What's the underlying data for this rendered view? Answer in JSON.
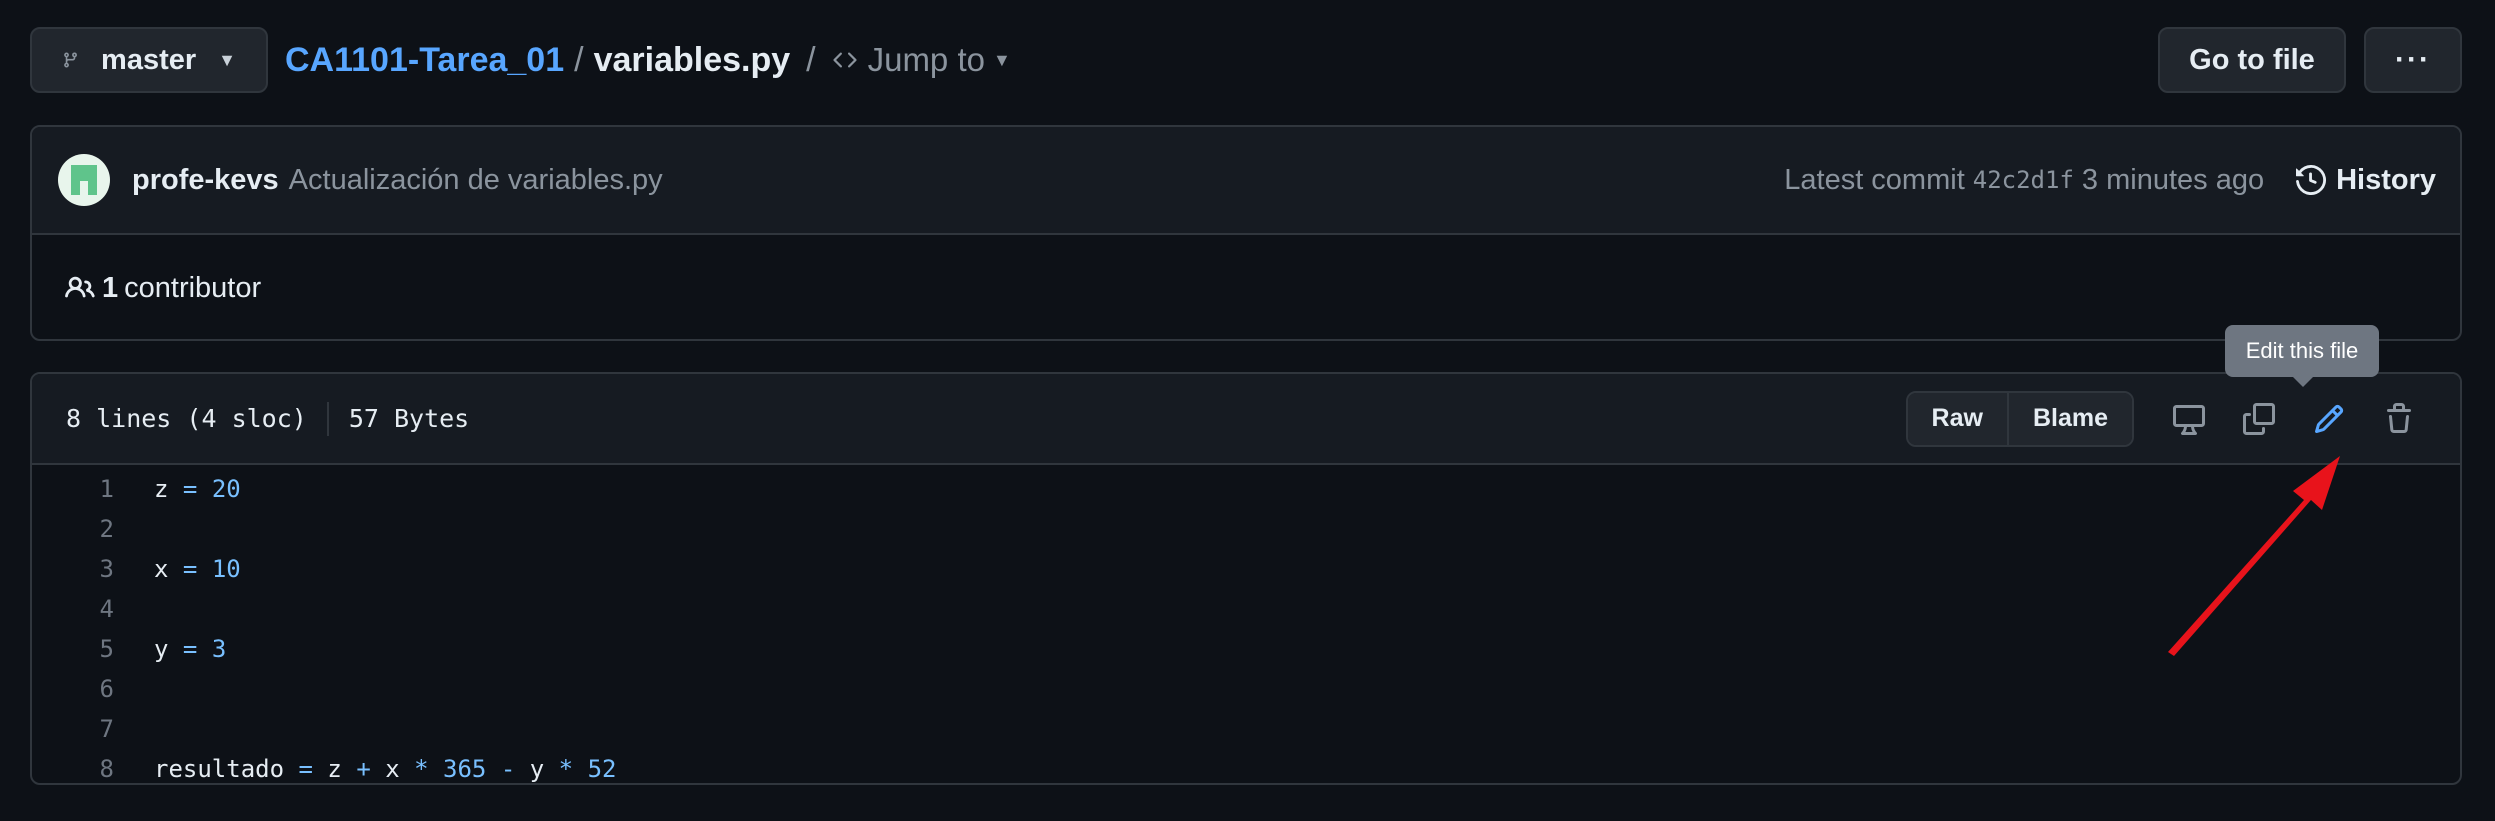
{
  "branch": {
    "name": "master"
  },
  "breadcrumb": {
    "repo": "CA1101-Tarea_01",
    "sep1": "/",
    "file": "variables.py",
    "sep2": "/",
    "jump_label": "Jump to"
  },
  "actions": {
    "go_to_file": "Go to file",
    "more": "···"
  },
  "commit": {
    "author": "profe-kevs",
    "message": "Actualización de variables.py",
    "latest_label": "Latest commit",
    "sha": "42c2d1f",
    "time": "3 minutes ago",
    "history_label": "History"
  },
  "contributors": {
    "count": "1",
    "label": "contributor"
  },
  "file_info": {
    "lines": "8 lines (4 sloc)",
    "size": "57 Bytes"
  },
  "file_actions": {
    "raw": "Raw",
    "blame": "Blame",
    "tooltip": "Edit this file"
  },
  "code_lines": [
    {
      "n": "1",
      "tokens": [
        {
          "t": "z",
          "c": "id"
        },
        {
          "t": " ",
          "c": "ws"
        },
        {
          "t": "=",
          "c": "op"
        },
        {
          "t": " ",
          "c": "ws"
        },
        {
          "t": "20",
          "c": "num"
        }
      ]
    },
    {
      "n": "2",
      "tokens": []
    },
    {
      "n": "3",
      "tokens": [
        {
          "t": "x",
          "c": "id"
        },
        {
          "t": " ",
          "c": "ws"
        },
        {
          "t": "=",
          "c": "op"
        },
        {
          "t": " ",
          "c": "ws"
        },
        {
          "t": "10",
          "c": "num"
        }
      ]
    },
    {
      "n": "4",
      "tokens": []
    },
    {
      "n": "5",
      "tokens": [
        {
          "t": "y",
          "c": "id"
        },
        {
          "t": " ",
          "c": "ws"
        },
        {
          "t": "=",
          "c": "op"
        },
        {
          "t": " ",
          "c": "ws"
        },
        {
          "t": "3",
          "c": "num"
        }
      ]
    },
    {
      "n": "6",
      "tokens": []
    },
    {
      "n": "7",
      "tokens": []
    },
    {
      "n": "8",
      "tokens": [
        {
          "t": "resultado",
          "c": "id"
        },
        {
          "t": " ",
          "c": "ws"
        },
        {
          "t": "=",
          "c": "op"
        },
        {
          "t": " z ",
          "c": "id"
        },
        {
          "t": "+",
          "c": "op"
        },
        {
          "t": " x ",
          "c": "id"
        },
        {
          "t": "*",
          "c": "op"
        },
        {
          "t": " ",
          "c": "ws"
        },
        {
          "t": "365",
          "c": "num"
        },
        {
          "t": " ",
          "c": "ws"
        },
        {
          "t": "-",
          "c": "op"
        },
        {
          "t": " y ",
          "c": "id"
        },
        {
          "t": "*",
          "c": "op"
        },
        {
          "t": " ",
          "c": "ws"
        },
        {
          "t": "52",
          "c": "num"
        }
      ]
    }
  ],
  "colors": {
    "accent": "#58a6ff",
    "annotation_arrow": "#e8131b",
    "background": "#0d1117"
  },
  "icons": [
    "git-branch-icon",
    "caret-down-icon",
    "code-icon",
    "kebab-icon",
    "history-icon",
    "people-icon",
    "desktop-icon",
    "copy-icon",
    "pencil-icon",
    "trash-icon"
  ]
}
